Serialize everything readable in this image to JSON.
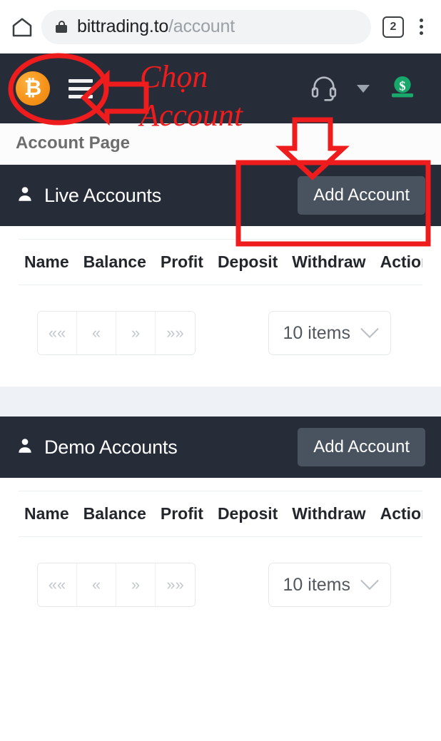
{
  "browser": {
    "home_icon": "home-icon",
    "lock_icon": "lock-icon",
    "url_domain": "bittrading.to",
    "url_path": "/account",
    "tab_count": "2",
    "menu_icon": "kebab-menu-icon"
  },
  "navbar": {
    "logo_glyph": "₿",
    "logo_name": "bitcoin-logo",
    "menu_icon": "hamburger-menu-icon",
    "support_icon": "headset-icon",
    "dropdown_icon": "caret-down-icon",
    "deposit_icon": "money-coin-icon"
  },
  "page": {
    "title": "Account Page"
  },
  "sections": [
    {
      "id": "live",
      "title": "Live Accounts",
      "icon": "user-icon",
      "add_button": "Add Account",
      "columns": [
        "Name",
        "Balance",
        "Profit",
        "Deposit",
        "Withdraw",
        "Actions"
      ],
      "rows": [],
      "pagination": {
        "first": "««",
        "prev": "«",
        "next": "»",
        "last": "»»"
      },
      "page_size": "10 items"
    },
    {
      "id": "demo",
      "title": "Demo Accounts",
      "icon": "user-icon",
      "add_button": "Add Account",
      "columns": [
        "Name",
        "Balance",
        "Profit",
        "Deposit",
        "Withdraw",
        "Actions"
      ],
      "rows": [],
      "pagination": {
        "first": "««",
        "prev": "«",
        "next": "»",
        "last": "»»"
      },
      "page_size": "10 items"
    }
  ],
  "annotations": {
    "color": "#ee1c1c",
    "line1": "Chọn",
    "line2": "Account",
    "ellipse_target": "hamburger-menu-icon",
    "arrow_left_target": "hamburger-menu-icon",
    "rect_target": "add-account-button",
    "arrow_down_target": "add-account-button"
  }
}
